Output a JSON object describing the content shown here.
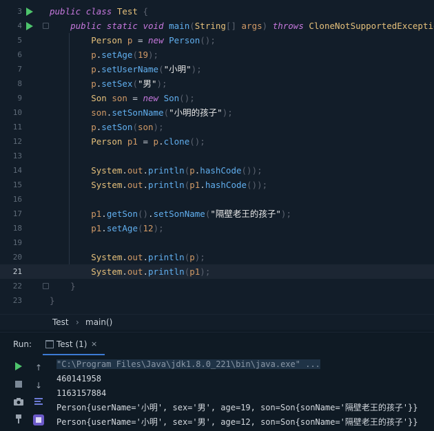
{
  "editor": {
    "lines": [
      {
        "n": "3",
        "segs": [
          [
            "kw",
            "public"
          ],
          [
            "pl",
            " "
          ],
          [
            "kw",
            "class"
          ],
          [
            "pl",
            " "
          ],
          [
            "id",
            "Test"
          ],
          [
            "pr",
            " {"
          ]
        ]
      },
      {
        "n": "4",
        "segs": [
          [
            "pl",
            "    "
          ],
          [
            "kw",
            "public"
          ],
          [
            "pl",
            " "
          ],
          [
            "kw",
            "static"
          ],
          [
            "pl",
            " "
          ],
          [
            "kw",
            "void"
          ],
          [
            "pl",
            " "
          ],
          [
            "fn",
            "main"
          ],
          [
            "pr",
            "("
          ],
          [
            "id",
            "String"
          ],
          [
            "pr",
            "[]"
          ],
          [
            "pl",
            " "
          ],
          [
            "var",
            "args"
          ],
          [
            "pr",
            ")"
          ],
          [
            "pl",
            " "
          ],
          [
            "kw",
            "throws"
          ],
          [
            "pl",
            " "
          ],
          [
            "id",
            "CloneNotSupportedException"
          ],
          [
            "pr",
            " {"
          ]
        ]
      },
      {
        "n": "5",
        "segs": [
          [
            "pl",
            "        "
          ],
          [
            "id",
            "Person"
          ],
          [
            "pl",
            " "
          ],
          [
            "var",
            "p"
          ],
          [
            "pl",
            " = "
          ],
          [
            "kw",
            "new"
          ],
          [
            "pl",
            " "
          ],
          [
            "fn",
            "Person"
          ],
          [
            "pr",
            "();"
          ]
        ]
      },
      {
        "n": "6",
        "segs": [
          [
            "pl",
            "        "
          ],
          [
            "var",
            "p"
          ],
          [
            "pl",
            "."
          ],
          [
            "fn",
            "setAge"
          ],
          [
            "pr",
            "("
          ],
          [
            "num",
            "19"
          ],
          [
            "pr",
            ");"
          ]
        ]
      },
      {
        "n": "7",
        "segs": [
          [
            "pl",
            "        "
          ],
          [
            "var",
            "p"
          ],
          [
            "pl",
            "."
          ],
          [
            "fn",
            "setUserName"
          ],
          [
            "pr",
            "("
          ],
          [
            "str",
            "\"小明\""
          ],
          [
            "pr",
            ");"
          ]
        ]
      },
      {
        "n": "8",
        "segs": [
          [
            "pl",
            "        "
          ],
          [
            "var",
            "p"
          ],
          [
            "pl",
            "."
          ],
          [
            "fn",
            "setSex"
          ],
          [
            "pr",
            "("
          ],
          [
            "str",
            "\"男\""
          ],
          [
            "pr",
            ");"
          ]
        ]
      },
      {
        "n": "9",
        "segs": [
          [
            "pl",
            "        "
          ],
          [
            "id",
            "Son"
          ],
          [
            "pl",
            " "
          ],
          [
            "var",
            "son"
          ],
          [
            "pl",
            " = "
          ],
          [
            "kw",
            "new"
          ],
          [
            "pl",
            " "
          ],
          [
            "fn",
            "Son"
          ],
          [
            "pr",
            "();"
          ]
        ]
      },
      {
        "n": "10",
        "segs": [
          [
            "pl",
            "        "
          ],
          [
            "var",
            "son"
          ],
          [
            "pl",
            "."
          ],
          [
            "fn",
            "setSonName"
          ],
          [
            "pr",
            "("
          ],
          [
            "str",
            "\"小明的孩子\""
          ],
          [
            "pr",
            ");"
          ]
        ]
      },
      {
        "n": "11",
        "segs": [
          [
            "pl",
            "        "
          ],
          [
            "var",
            "p"
          ],
          [
            "pl",
            "."
          ],
          [
            "fn",
            "setSon"
          ],
          [
            "pr",
            "("
          ],
          [
            "var",
            "son"
          ],
          [
            "pr",
            ");"
          ]
        ]
      },
      {
        "n": "12",
        "segs": [
          [
            "pl",
            "        "
          ],
          [
            "id",
            "Person"
          ],
          [
            "pl",
            " "
          ],
          [
            "var",
            "p1"
          ],
          [
            "pl",
            " = "
          ],
          [
            "var",
            "p"
          ],
          [
            "pl",
            "."
          ],
          [
            "fn",
            "clone"
          ],
          [
            "pr",
            "();"
          ]
        ]
      },
      {
        "n": "13",
        "segs": []
      },
      {
        "n": "14",
        "segs": [
          [
            "pl",
            "        "
          ],
          [
            "id",
            "System"
          ],
          [
            "pl",
            "."
          ],
          [
            "var",
            "out"
          ],
          [
            "pl",
            "."
          ],
          [
            "fn",
            "println"
          ],
          [
            "pr",
            "("
          ],
          [
            "var",
            "p"
          ],
          [
            "pl",
            "."
          ],
          [
            "fn",
            "hashCode"
          ],
          [
            "pr",
            "());"
          ]
        ]
      },
      {
        "n": "15",
        "segs": [
          [
            "pl",
            "        "
          ],
          [
            "id",
            "System"
          ],
          [
            "pl",
            "."
          ],
          [
            "var",
            "out"
          ],
          [
            "pl",
            "."
          ],
          [
            "fn",
            "println"
          ],
          [
            "pr",
            "("
          ],
          [
            "var",
            "p1"
          ],
          [
            "pl",
            "."
          ],
          [
            "fn",
            "hashCode"
          ],
          [
            "pr",
            "());"
          ]
        ]
      },
      {
        "n": "16",
        "segs": []
      },
      {
        "n": "17",
        "segs": [
          [
            "pl",
            "        "
          ],
          [
            "var",
            "p1"
          ],
          [
            "pl",
            "."
          ],
          [
            "fn",
            "getSon"
          ],
          [
            "pr",
            "()"
          ],
          [
            "pl",
            "."
          ],
          [
            "fn",
            "setSonName"
          ],
          [
            "pr",
            "("
          ],
          [
            "str",
            "\"隔壁老王的孩子\""
          ],
          [
            "pr",
            ");"
          ]
        ]
      },
      {
        "n": "18",
        "segs": [
          [
            "pl",
            "        "
          ],
          [
            "var",
            "p1"
          ],
          [
            "pl",
            "."
          ],
          [
            "fn",
            "setAge"
          ],
          [
            "pr",
            "("
          ],
          [
            "num",
            "12"
          ],
          [
            "pr",
            ");"
          ]
        ]
      },
      {
        "n": "19",
        "segs": []
      },
      {
        "n": "20",
        "segs": [
          [
            "pl",
            "        "
          ],
          [
            "id",
            "System"
          ],
          [
            "pl",
            "."
          ],
          [
            "var",
            "out"
          ],
          [
            "pl",
            "."
          ],
          [
            "fn",
            "println"
          ],
          [
            "pr",
            "("
          ],
          [
            "var",
            "p"
          ],
          [
            "pr",
            ");"
          ]
        ]
      },
      {
        "n": "21",
        "segs": [
          [
            "pl",
            "        "
          ],
          [
            "id",
            "System"
          ],
          [
            "pl",
            "."
          ],
          [
            "var",
            "out"
          ],
          [
            "pl",
            "."
          ],
          [
            "fn",
            "println"
          ],
          [
            "pr",
            "("
          ],
          [
            "var",
            "p1"
          ],
          [
            "pr",
            ");"
          ]
        ]
      },
      {
        "n": "22",
        "segs": [
          [
            "pr",
            "    }"
          ]
        ]
      },
      {
        "n": "23",
        "segs": [
          [
            "pr",
            "}"
          ]
        ]
      }
    ],
    "current_line": "21"
  },
  "breadcrumb": {
    "class_name": "Test",
    "separator": "›",
    "method": "main()"
  },
  "run_panel": {
    "label": "Run:",
    "tab_label": "Test (1)",
    "tab_close": "×"
  },
  "console": {
    "command": "\"C:\\Program Files\\Java\\jdk1.8.0_221\\bin\\java.exe\" ...",
    "output": [
      "460141958",
      "1163157884",
      "Person{userName='小明', sex='男', age=19, son=Son{sonName='隔壁老王的孩子'}}",
      "Person{userName='小明', sex='男', age=12, son=Son{sonName='隔壁老王的孩子'}}"
    ]
  },
  "colors": {
    "accent": "#3d7bd4",
    "run_green": "#4ec46c"
  },
  "icons": [
    "run-icon",
    "up-arrow-icon",
    "stop-icon",
    "down-arrow-icon",
    "camera-icon",
    "soft-wrap-icon",
    "pin-icon",
    "print-icon",
    "run-test-icon"
  ]
}
